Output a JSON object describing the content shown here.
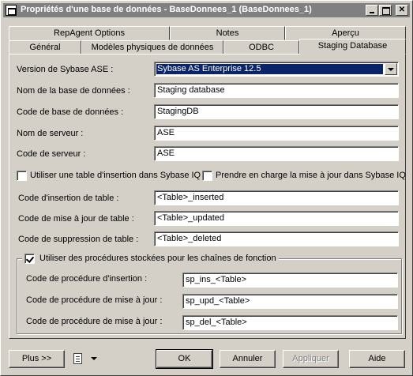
{
  "window": {
    "title": "Propriétés d'une base de données - BaseDonnees_1 (BaseDonnees_1)"
  },
  "tabs": {
    "row_back": [
      "RepAgent Options",
      "Notes",
      "Aperçu"
    ],
    "row_front": [
      "Général",
      "Modèles physiques de données",
      "ODBC",
      "Staging Database"
    ],
    "active": "Staging Database"
  },
  "form": {
    "version_label": "Version de Sybase ASE :",
    "version_value": "Sybase AS Enterprise 12.5",
    "dbname_label": "Nom de la base de données :",
    "dbname_value": "Staging database",
    "dbcode_label": "Code de base de données :",
    "dbcode_value": "StagingDB",
    "server_name_label": "Nom de serveur :",
    "server_name_value": "ASE",
    "server_code_label": "Code de serveur :",
    "server_code_value": "ASE",
    "use_insert_table_label": "Utiliser une table d'insertion dans Sybase IQ",
    "use_insert_table_checked": false,
    "support_update_label": "Prendre en charge la mise à jour dans Sybase IQ",
    "support_update_checked": false,
    "insert_code_label": "Code d'insertion de table :",
    "insert_code_value": "<Table>_inserted",
    "update_code_label": "Code de mise à jour de table :",
    "update_code_value": "<Table>_updated",
    "delete_code_label": "Code de suppression de table :",
    "delete_code_value": "<Table>_deleted"
  },
  "group": {
    "label": "Utiliser des procédures stockées pour les chaînes de fonction",
    "checked": true,
    "proc_insert_label": "Code de procédure d'insertion :",
    "proc_insert_value": "sp_ins_<Table>",
    "proc_update_label": "Code de procédure de mise à jour :",
    "proc_update_value": "sp_upd_<Table>",
    "proc_delete_label": "Code de procédure de mise à jour :",
    "proc_delete_value": "sp_del_<Table>"
  },
  "buttons": {
    "more": "Plus >>",
    "ok": "OK",
    "cancel": "Annuler",
    "apply": "Appliquer",
    "help": "Aide",
    "menu_icon": "document-menu-icon"
  },
  "colors": {
    "face": "#d4d0c8",
    "title_inactive": "#808080",
    "selection": "#0a246a"
  }
}
